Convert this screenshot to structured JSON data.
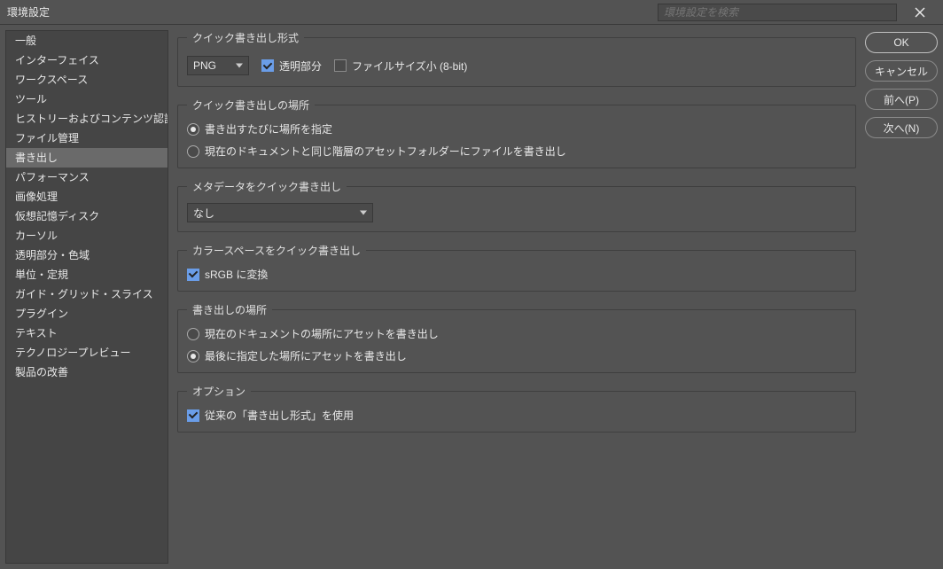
{
  "titlebar": {
    "title": "環境設定",
    "search_placeholder": "環境設定を検索"
  },
  "sidebar": {
    "items": [
      "一般",
      "インターフェイス",
      "ワークスペース",
      "ツール",
      "ヒストリーおよびコンテンツ認証情報",
      "ファイル管理",
      "書き出し",
      "パフォーマンス",
      "画像処理",
      "仮想記憶ディスク",
      "カーソル",
      "透明部分・色域",
      "単位・定規",
      "ガイド・グリッド・スライス",
      "プラグイン",
      "テキスト",
      "テクノロジープレビュー",
      "製品の改善"
    ],
    "selected_index": 6
  },
  "buttons": {
    "ok": "OK",
    "cancel": "キャンセル",
    "prev": "前へ(P)",
    "next": "次へ(N)"
  },
  "groups": {
    "format": {
      "legend": "クイック書き出し形式",
      "format_value": "PNG",
      "cb_transparent": "透明部分",
      "cb_transparent_checked": true,
      "cb_small8bit": "ファイルサイズ小 (8-bit)",
      "cb_small8bit_checked": false
    },
    "location": {
      "legend": "クイック書き出しの場所",
      "r1": "書き出すたびに場所を指定",
      "r2": "現在のドキュメントと同じ階層のアセットフォルダーにファイルを書き出し",
      "selected": 0
    },
    "metadata": {
      "legend": "メタデータをクイック書き出し",
      "value": "なし"
    },
    "colorspace": {
      "legend": "カラースペースをクイック書き出し",
      "cb_srgb": "sRGB に変換",
      "cb_srgb_checked": true
    },
    "exportloc": {
      "legend": "書き出しの場所",
      "r1": "現在のドキュメントの場所にアセットを書き出し",
      "r2": "最後に指定した場所にアセットを書き出し",
      "selected": 1
    },
    "options": {
      "legend": "オプション",
      "cb_legacy": "従来の「書き出し形式」を使用",
      "cb_legacy_checked": true
    }
  }
}
